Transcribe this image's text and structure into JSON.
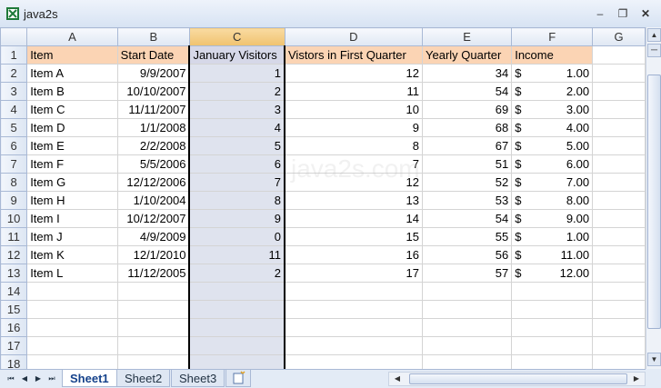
{
  "window": {
    "title": "java2s",
    "icon": "excel-icon"
  },
  "watermark": "java2s.com",
  "columns": [
    "A",
    "B",
    "C",
    "D",
    "E",
    "F",
    "G"
  ],
  "header_row": [
    "Item",
    "Start Date",
    "January Visitors",
    "Vistors in First Quarter",
    "Yearly Quarter",
    "Income"
  ],
  "rows": [
    [
      "Item A",
      "9/9/2007",
      "1",
      "12",
      "34",
      "$",
      "1.00"
    ],
    [
      "Item B",
      "10/10/2007",
      "2",
      "11",
      "54",
      "$",
      "2.00"
    ],
    [
      "Item C",
      "11/11/2007",
      "3",
      "10",
      "69",
      "$",
      "3.00"
    ],
    [
      "Item D",
      "1/1/2008",
      "4",
      "9",
      "68",
      "$",
      "4.00"
    ],
    [
      "Item E",
      "2/2/2008",
      "5",
      "8",
      "67",
      "$",
      "5.00"
    ],
    [
      "Item F",
      "5/5/2006",
      "6",
      "7",
      "51",
      "$",
      "6.00"
    ],
    [
      "Item G",
      "12/12/2006",
      "7",
      "12",
      "52",
      "$",
      "7.00"
    ],
    [
      "Item H",
      "1/10/2004",
      "8",
      "13",
      "53",
      "$",
      "8.00"
    ],
    [
      "Item I",
      "10/12/2007",
      "9",
      "14",
      "54",
      "$",
      "9.00"
    ],
    [
      "Item J",
      "4/9/2009",
      "0",
      "15",
      "55",
      "$",
      "1.00"
    ],
    [
      "Item K",
      "12/1/2010",
      "11",
      "16",
      "56",
      "$",
      "11.00"
    ],
    [
      "Item L",
      "11/12/2005",
      "2",
      "17",
      "57",
      "$",
      "12.00"
    ]
  ],
  "row_numbers": [
    "1",
    "2",
    "3",
    "4",
    "5",
    "6",
    "7",
    "8",
    "9",
    "10",
    "11",
    "12",
    "13",
    "14",
    "15",
    "16",
    "17",
    "18"
  ],
  "sheets": [
    "Sheet1",
    "Sheet2",
    "Sheet3"
  ],
  "active_sheet": "Sheet1",
  "colors": {
    "header_fill": "#fbd4b4",
    "selected_column": "#dfe3ee",
    "grid_header": "#dfe7f3"
  }
}
